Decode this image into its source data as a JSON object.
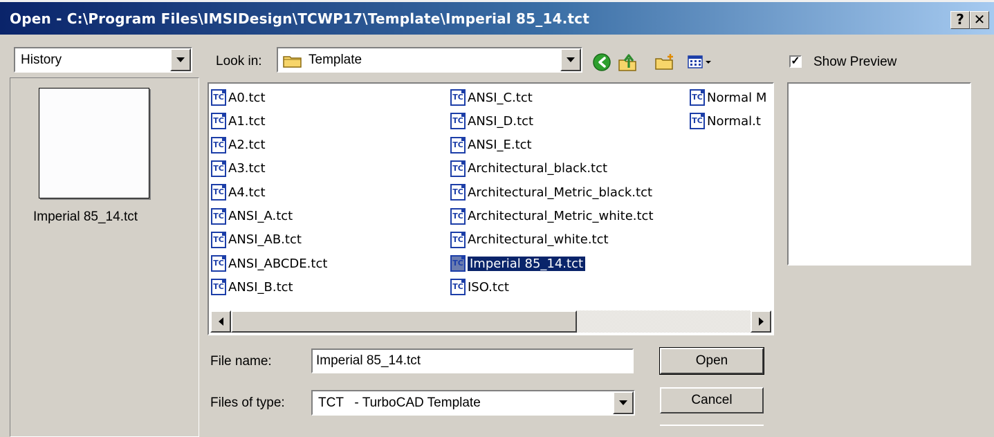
{
  "window": {
    "title": "Open - C:\\Program Files\\IMSIDesign\\TCWP17\\Template\\Imperial 85_14.tct",
    "help_label": "?",
    "close_label": "✕"
  },
  "places": {
    "dropdown_value": "History",
    "preview_filename": "Imperial 85_14.tct"
  },
  "look_in": {
    "label": "Look in:",
    "value": "Template",
    "toolbar_icons": [
      "back-icon",
      "up-folder-icon",
      "new-folder-icon",
      "view-menu-icon"
    ]
  },
  "files": {
    "col1": [
      "A0.tct",
      "A1.tct",
      "A2.tct",
      "A3.tct",
      "A4.tct",
      "ANSI_A.tct",
      "ANSI_AB.tct",
      "ANSI_ABCDE.tct",
      "ANSI_B.tct"
    ],
    "col2": [
      "ANSI_C.tct",
      "ANSI_D.tct",
      "ANSI_E.tct",
      "Architectural_black.tct",
      "Architectural_Metric_black.tct",
      "Architectural_Metric_white.tct",
      "Architectural_white.tct",
      "Imperial 85_14.tct",
      "ISO.tct"
    ],
    "col3": [
      "Normal M",
      "Normal.t"
    ],
    "selected": "Imperial 85_14.tct",
    "icon_text": "TC"
  },
  "preview": {
    "checkbox_label": "Show Preview",
    "checked": true,
    "check_mark": "✓"
  },
  "file_name": {
    "label": "File name:",
    "value": "Imperial 85_14.tct"
  },
  "file_type": {
    "label": "Files of type:",
    "value": "TCT   - TurboCAD Template"
  },
  "buttons": {
    "open": "Open",
    "cancel": "Cancel"
  }
}
